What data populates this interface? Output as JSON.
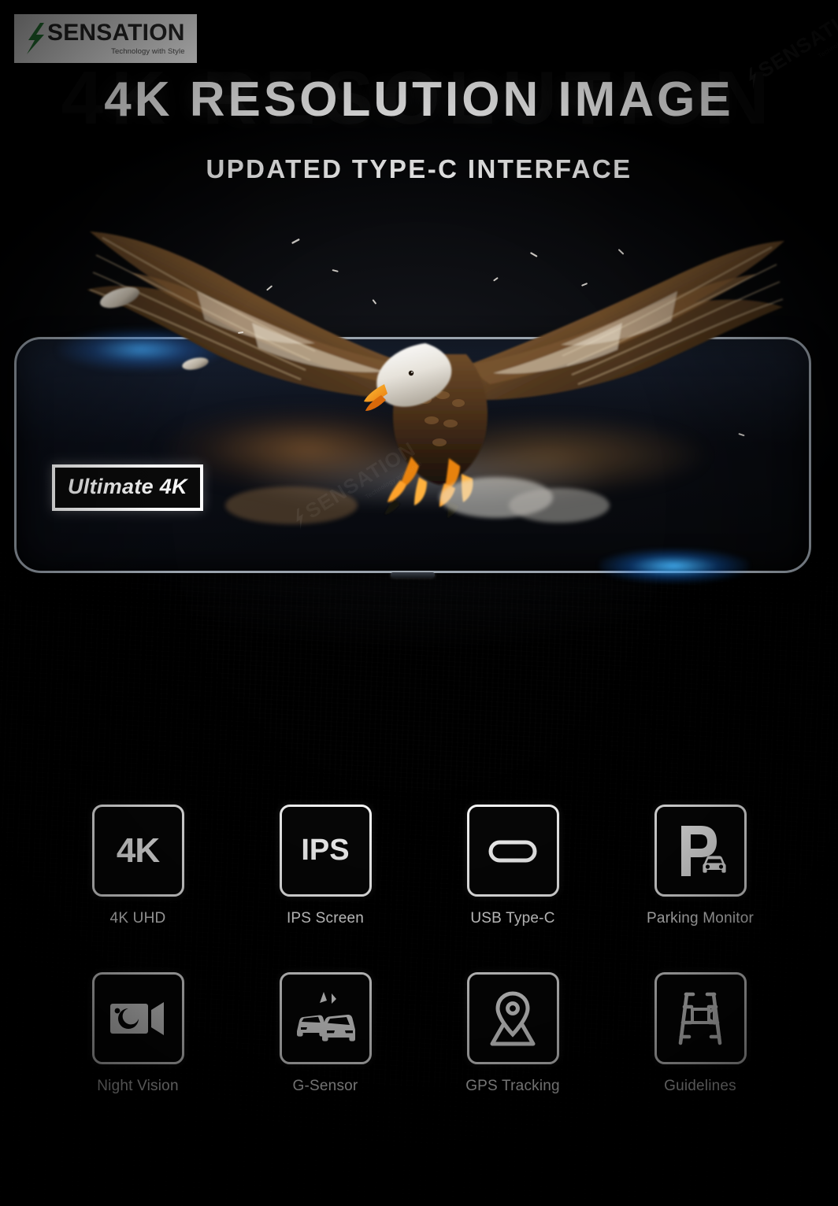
{
  "brand": {
    "name": "SENSATION",
    "tagline": "Technology with Style",
    "bolt_color": "#2d8b3e",
    "name_color": "#2b2b2b",
    "logo_bg": "#ffffff"
  },
  "watermark": {
    "name": "SENSATION",
    "tagline": "Technology with Style"
  },
  "hero": {
    "headline": "4K RESOLUTION IMAGE",
    "subhead": "UPDATED TYPE-C INTERFACE",
    "ghost_text": "4K RESOLUTION",
    "badge": "Ultimate 4K",
    "image_subject": "bald-eagle-in-flight",
    "device": "rearview-mirror-dash-cam",
    "glow_color": "#3cb4ff",
    "frame_color": "#9aa3ad"
  },
  "features": {
    "rows": [
      [
        {
          "icon": "4k-icon",
          "glyph": "4K",
          "label": "4K UHD"
        },
        {
          "icon": "ips-icon",
          "glyph": "IPS",
          "label": "IPS Screen"
        },
        {
          "icon": "usb-type-c-icon",
          "glyph": "",
          "label": "USB Type-C"
        },
        {
          "icon": "parking-monitor-icon",
          "glyph": "",
          "label": "Parking Monitor"
        }
      ],
      [
        {
          "icon": "night-vision-icon",
          "glyph": "",
          "label": "Night Vision"
        },
        {
          "icon": "g-sensor-icon",
          "glyph": "",
          "label": "G-Sensor"
        },
        {
          "icon": "gps-tracking-icon",
          "glyph": "",
          "label": "GPS Tracking"
        },
        {
          "icon": "guidelines-icon",
          "glyph": "",
          "label": "Guidelines"
        }
      ]
    ]
  },
  "colors": {
    "background": "#000000",
    "text": "#ffffff",
    "accent_blue": "#3cb4ff",
    "brand_green": "#2d8b3e"
  }
}
